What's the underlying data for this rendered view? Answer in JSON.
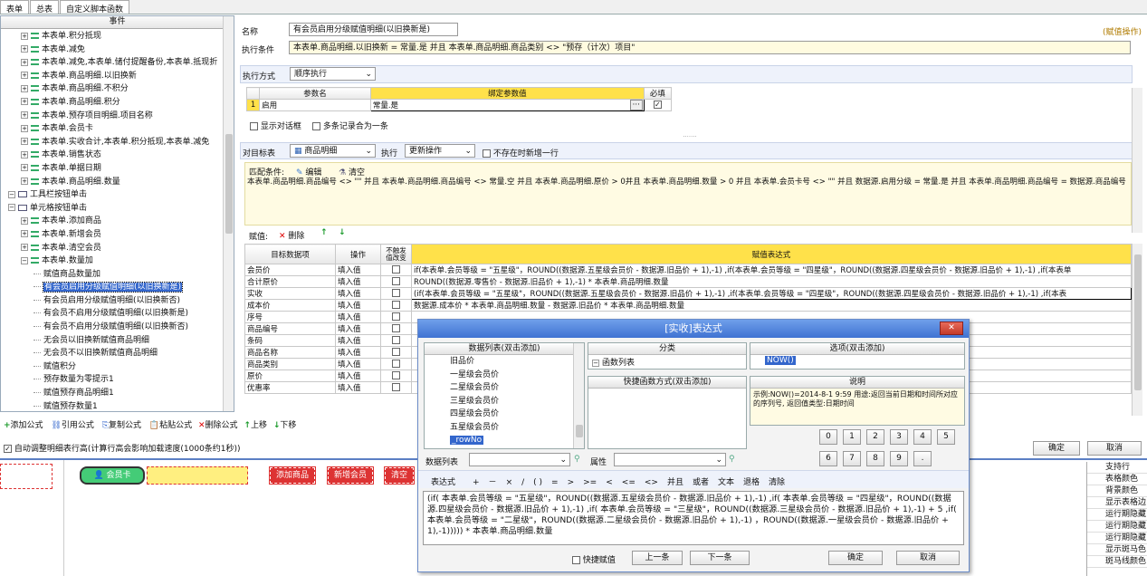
{
  "tabs": [
    "表单",
    "总表",
    "自定义脚本函数"
  ],
  "tree": {
    "header": "事件",
    "items": [
      {
        "t": "本表单.积分抵现",
        "l": 1,
        "ic": true,
        "pm": "+"
      },
      {
        "t": "本表单.减免",
        "l": 1,
        "ic": true,
        "pm": "+"
      },
      {
        "t": "本表单.减免,本表单.储付提醒备份,本表单.抵现折",
        "l": 1,
        "ic": true,
        "pm": "+"
      },
      {
        "t": "本表单.商品明细.以旧换新",
        "l": 1,
        "ic": true,
        "pm": "+"
      },
      {
        "t": "本表单.商品明细.不积分",
        "l": 1,
        "ic": true,
        "pm": "+"
      },
      {
        "t": "本表单.商品明细.积分",
        "l": 1,
        "ic": true,
        "pm": "+"
      },
      {
        "t": "本表单.预存项目明细.项目名称",
        "l": 1,
        "ic": true,
        "pm": "+"
      },
      {
        "t": "本表单.会员卡",
        "l": 1,
        "ic": true,
        "pm": "+"
      },
      {
        "t": "本表单.实收合计,本表单.积分抵现,本表单.减免",
        "l": 1,
        "ic": true,
        "pm": "+"
      },
      {
        "t": "本表单.销售状态",
        "l": 1,
        "ic": true,
        "pm": "+"
      },
      {
        "t": "本表单.单据日期",
        "l": 1,
        "ic": true,
        "pm": "+"
      },
      {
        "t": "本表单.商品明细.数量",
        "l": 1,
        "ic": true,
        "pm": "+"
      },
      {
        "t": "工具栏按钮单击",
        "l": 0,
        "ic": false,
        "pm": "-",
        "bx": true
      },
      {
        "t": "单元格按钮单击",
        "l": 0,
        "ic": false,
        "pm": "-",
        "bx": true
      },
      {
        "t": "本表单.添加商品",
        "l": 1,
        "ic": true,
        "pm": "+"
      },
      {
        "t": "本表单.新增会员",
        "l": 1,
        "ic": true,
        "pm": "+"
      },
      {
        "t": "本表单.清空会员",
        "l": 1,
        "ic": true,
        "pm": "+"
      },
      {
        "t": "本表单.数量加",
        "l": 1,
        "ic": true,
        "pm": "-"
      },
      {
        "t": "赋值商品数量加",
        "l": 2
      },
      {
        "t": "有会员启用分级赋值明细(以旧换新是)",
        "l": 2,
        "sel": true
      },
      {
        "t": "有会员启用分级赋值明细(以旧换新否)",
        "l": 2
      },
      {
        "t": "有会员不启用分级赋值明细(以旧换新是)",
        "l": 2
      },
      {
        "t": "有会员不启用分级赋值明细(以旧换新否)",
        "l": 2
      },
      {
        "t": "无会员以旧换新赋值商品明细",
        "l": 2
      },
      {
        "t": "无会员不以旧换新赋值商品明细",
        "l": 2
      },
      {
        "t": "赋值积分",
        "l": 2
      },
      {
        "t": "预存数量为零提示1",
        "l": 2
      },
      {
        "t": "赋值预存商品明细1",
        "l": 2
      },
      {
        "t": "赋值预存数量1",
        "l": 2
      }
    ]
  },
  "form": {
    "name_label": "名称",
    "name_value": "有会员启用分级赋值明细(以旧换新是)",
    "edit_link": "(赋值操作)",
    "cond_label": "执行条件",
    "cond_value": "本表单.商品明细.以旧换新 = 常量.是 并且 本表单.商品明细.商品类别 <> \"预存（计次）项目\"",
    "mode_label": "执行方式",
    "mode_value": "顺序执行",
    "param_headers": [
      "参数名",
      "绑定参数值",
      "必填"
    ],
    "param_row": {
      "num": "1",
      "name": "启用",
      "value": "常量.是",
      "dots": "···"
    },
    "show_dialog": "显示对话框",
    "multi_as_one": "多条记录合为一条",
    "target_label": "对目标表",
    "target_value": "商品明细",
    "exec_label": "执行",
    "exec_value": "更新操作",
    "add_row_label": "不存在时新增一行",
    "match_label": "匹配条件:",
    "edit_btn": "编辑",
    "clear_btn": "清空",
    "match_text": "本表单.商品明细.商品编号 <> \"\" 并且 本表单.商品明细.商品编号 <> 常量.空 并且 本表单.商品明细.原价 > 0并且 本表单.商品明细.数量 > 0 并且 本表单.会员卡号 <> \"\" 并且 数据源.启用分级 = 常量.是 并且 本表单.商品明细.商品编号 = 数据源.商品编号",
    "assign_label": "赋值:",
    "delete_btn": "删除",
    "grid_headers": [
      "目标数据项",
      "操作",
      "不触发值改变",
      "赋值表达式"
    ],
    "grid_rows": [
      [
        "会员价",
        "填入值",
        "if(本表单.会员等级 = \"五星级\"，ROUND((数据源.五星级会员价 - 数据源.旧品价 + 1),-1) ,if(本表单.会员等级 = \"四星级\"，ROUND((数据源.四星级会员价 - 数据源.旧品价 + 1),-1) ,if(本表单"
      ],
      [
        "合计原价",
        "填入值",
        "ROUND((数据源.零售价 - 数据源.旧品价 + 1),-1) * 本表单.商品明细.数量"
      ],
      [
        "实收",
        "填入值",
        "(if(本表单.会员等级 = \"五星级\"，ROUND((数据源.五星级会员价 - 数据源.旧品价 + 1),-1) ,if(本表单.会员等级 = \"四星级\"，ROUND((数据源.四星级会员价 - 数据源.旧品价 + 1),-1) ,if(本表"
      ],
      [
        "成本价",
        "填入值",
        "数据源.成本价 * 本表单.商品明细.数量 - 数据源.旧品价 * 本表单.商品明细.数量"
      ],
      [
        "序号",
        "填入值",
        ""
      ],
      [
        "商品编号",
        "填入值",
        ""
      ],
      [
        "条码",
        "填入值",
        ""
      ],
      [
        "商品名称",
        "填入值",
        ""
      ],
      [
        "商品类别",
        "填入值",
        ""
      ],
      [
        "原价",
        "填入值",
        ""
      ],
      [
        "优惠率",
        "填入值",
        ""
      ]
    ],
    "toolbar": [
      "添加公式",
      "引用公式",
      "复制公式",
      "粘贴公式",
      "删除公式",
      "上移",
      "下移"
    ],
    "autofit": "自动调整明细表行高(计算行高会影响加载速度(1000条约1秒))",
    "ok": "确定",
    "cancel": "取消"
  },
  "dialog": {
    "title": "[实收]表达式",
    "data_list_head": "数据列表(双击添加)",
    "data_items": [
      "旧品价",
      "一星级会员价",
      "二星级会员价",
      "三星级会员价",
      "四星级会员价",
      "五星级会员价",
      "_rowNo"
    ],
    "cat_head": "分类",
    "cat_item": "函数列表",
    "quick_head": "快捷函数方式(双击添加)",
    "opt_head": "选项(双击添加)",
    "opt_item": "NOW()",
    "desc_head": "说明",
    "desc_text": "示例:NOW()=2014-8-1 9:59 用途:返回当前日期和时间所对应的序列号, 返回值类型:日期时间",
    "nums": [
      "0",
      "1",
      "2",
      "3",
      "4",
      "5",
      "6",
      "7",
      "8",
      "9",
      "."
    ],
    "ds_label": "数据列表",
    "attr_label": "属性",
    "expr_label": "表达式",
    "ops": [
      "+",
      "－",
      "×",
      "/",
      "( )",
      "=",
      ">",
      ">=",
      "<",
      "<=",
      "<>",
      "并且",
      "或者",
      "文本",
      "退格",
      "清除"
    ],
    "expr": "(if( 本表单.会员等级 = \"五星级\"，ROUND((数据源.五星级会员价 - 数据源.旧品价 + 1),-1) ,if( 本表单.会员等级 = \"四星级\"，ROUND((数据源.四星级会员价 - 数据源.旧品价 + 1),-1) ,if( 本表单.会员等级 = \"三星级\"，ROUND((数据源.三星级会员价 - 数据源.旧品价 + 1),-1) + 5 ,if( 本表单.会员等级 = \"二星级\"，ROUND((数据源.二星级会员价 - 数据源.旧品价 + 1),-1) ，ROUND((数据源.一星级会员价 - 数据源.旧品价 + 1),-1))))) * 本表单.商品明细.数量",
    "quick_assign": "快捷赋值",
    "prev": "上一条",
    "next": "下一条",
    "ok": "确定",
    "cancel": "取消"
  },
  "designer": {
    "member_card": "会员卡",
    "add_goods": "添加商品",
    "add_member": "新增会员",
    "clear": "清空"
  },
  "props": [
    "支持行",
    "表格颜色",
    "背景颜色",
    "显示表格边",
    "运行期隐藏",
    "运行期隐藏",
    "运行期隐藏",
    "显示斑马色",
    "斑马线颜色"
  ]
}
